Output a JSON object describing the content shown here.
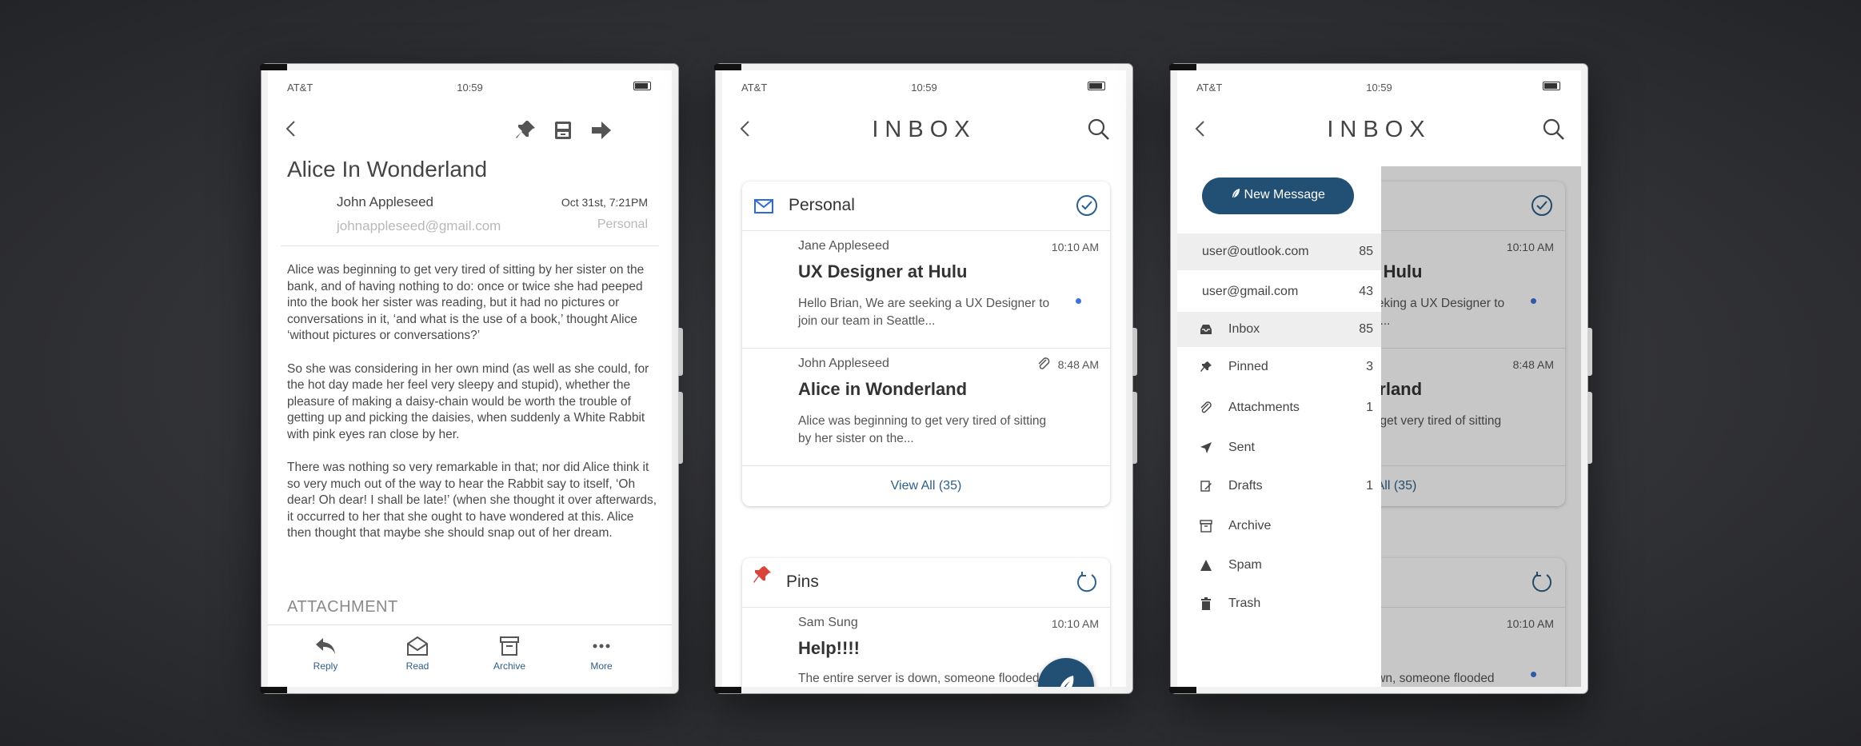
{
  "colors": {
    "accent": "#224f74",
    "link": "#2c5f8a",
    "unread_dot": "#3d72d6",
    "pin": "#d9453b"
  },
  "status": {
    "carrier": "AT&T",
    "time": "10:59"
  },
  "detail": {
    "title": "Alice In Wonderland",
    "sender": "John Appleseed",
    "date": "Oct 31st, 7:21PM",
    "email": "johnappleseed@gmail.com",
    "folder": "Personal",
    "paragraphs": [
      "Alice was beginning to get very tired of sitting by her sister on the bank, and of having nothing to do: once or twice she had peeped into the book her sister was reading, but it had no pictures or conversations in it, ‘and what is the use of a book,’ thought Alice ‘without pictures or conversations?’",
      "So she was considering in her own mind (as well as she could, for the hot day made her feel very sleepy and stupid), whether the pleasure of making a daisy-chain would be worth the trouble of getting up and picking the daisies, when suddenly a White Rabbit with pink eyes ran close by her.",
      "There was nothing so very remarkable in that; nor did Alice think it so very much out of the way to hear the Rabbit say to itself, ‘Oh dear! Oh dear! I shall be late!’ (when she thought it over afterwards, it occurred to her that she ought to have wondered at this. Alice then thought that maybe she should snap out of her dream."
    ],
    "attachment_heading": "ATTACHMENT",
    "tabs": {
      "reply": "Reply",
      "read": "Read",
      "archive": "Archive",
      "more": "More"
    }
  },
  "inbox": {
    "title": "INBOX",
    "personal": {
      "name": "Personal",
      "mails": [
        {
          "from": "Jane Appleseed",
          "time": "10:10 AM",
          "subject": "UX Designer at Hulu",
          "preview": "Hello Brian, We are seeking a UX Designer to join our team in Seattle..."
        },
        {
          "from": "John Appleseed",
          "time": "8:48 AM",
          "subject": "Alice in Wonderland",
          "preview": "Alice was beginning to get very tired of sitting by her sister on the..."
        }
      ],
      "view_all": "View All (35)"
    },
    "pins": {
      "name": "Pins",
      "mail": {
        "from": "Sam Sung",
        "time": "10:10 AM",
        "subject": "Help!!!!",
        "preview": "The entire server is down, someone flooded"
      }
    }
  },
  "drawer": {
    "new_message": "New Message",
    "accounts": [
      {
        "label": "user@outlook.com",
        "count": "85"
      },
      {
        "label": "user@gmail.com",
        "count": "43"
      }
    ],
    "folders": [
      {
        "label": "Inbox",
        "count": "85",
        "icon": "inbox-icon"
      },
      {
        "label": "Pinned",
        "count": "3",
        "icon": "pin-icon"
      },
      {
        "label": "Attachments",
        "count": "1",
        "icon": "paperclip-icon"
      },
      {
        "label": "Sent",
        "count": "",
        "icon": "send-icon"
      },
      {
        "label": "Drafts",
        "count": "1",
        "icon": "drafts-icon"
      },
      {
        "label": "Archive",
        "count": "",
        "icon": "archive-icon"
      },
      {
        "label": "Spam",
        "count": "",
        "icon": "spam-icon"
      },
      {
        "label": "Trash",
        "count": "",
        "icon": "trash-icon"
      }
    ]
  }
}
